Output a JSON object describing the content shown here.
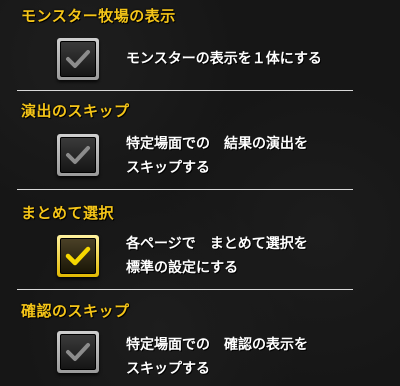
{
  "settings": {
    "items": [
      {
        "title": "モンスター牧場の表示",
        "description": "モンスターの表示を１体にする",
        "checked": false,
        "check_icon": "check-icon"
      },
      {
        "title": "演出のスキップ",
        "description": "特定場面での　結果の演出を\nスキップする",
        "checked": false,
        "check_icon": "check-icon"
      },
      {
        "title": "まとめて選択",
        "description": "各ページで　まとめて選択を\n標準の設定にする",
        "checked": true,
        "check_icon": "check-icon"
      },
      {
        "title": "確認のスキップ",
        "description": "特定場面での　確認の表示を\nスキップする",
        "checked": false,
        "check_icon": "check-icon"
      }
    ]
  },
  "colors": {
    "title": "#f5c518",
    "description": "#ffffff",
    "check_off": "#9a9a9a",
    "check_on": "#f7d800",
    "divider": "#d8d8d8",
    "background": "#161616"
  }
}
